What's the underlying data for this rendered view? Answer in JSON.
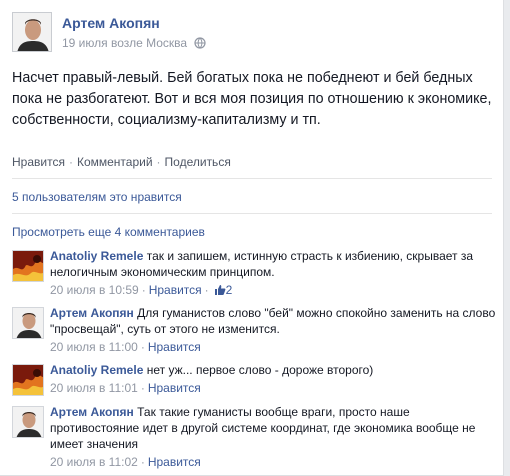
{
  "post": {
    "author": "Артем Акопян",
    "date": "19 июля возле Москва",
    "privacy_icon": "globe-icon",
    "text": "Насчет правый-левый. Бей богатых пока не победнеют и бей бедных пока не разбогатеют. Вот и вся моя позиция по отношению к экономике, собственности, социализму-капитализму и тп."
  },
  "actions": {
    "like": "Нравится",
    "comment": "Комментарий",
    "share": "Поделиться",
    "separator": "·"
  },
  "likes_summary": "5 пользователям это нравится",
  "view_more": "Просмотреть еще 4 комментариев",
  "comments": [
    {
      "author": "Anatoliy Remele",
      "text": "так и запишем, истинную страсть к избиению, скрывает за нелогичным экономическим принципом.",
      "time": "20 июля в 10:59",
      "like_label": "Нравится",
      "likes": "2"
    },
    {
      "author": "Артем Акопян",
      "text": "Для гуманистов слово \"бей\" можно спокойно заменить на слово \"просвещай\", суть от этого не изменится.",
      "time": "20 июля в 11:00",
      "like_label": "Нравится"
    },
    {
      "author": "Anatoliy Remele",
      "text": "нет уж... первое слово - дороже второго)",
      "time": "20 июля в 11:01",
      "like_label": "Нравится"
    },
    {
      "author": "Артем Акопян",
      "text": "Так такие гуманисты вообще враги, просто наше противостояние идет в другой системе координат, где экономика вообще не имеет значения",
      "time": "20 июля в 11:02",
      "like_label": "Нравится"
    }
  ],
  "colors": {
    "link": "#3b5998",
    "text": "#141823",
    "meta": "#9197a3"
  }
}
